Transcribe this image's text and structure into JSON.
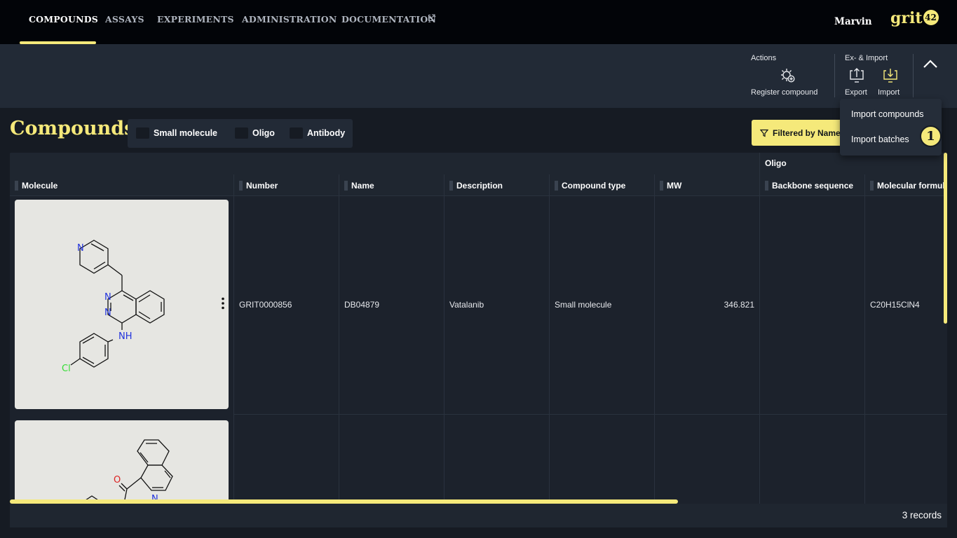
{
  "nav": {
    "items": [
      {
        "label": "COMPOUNDS"
      },
      {
        "label": "ASSAYS"
      },
      {
        "label": "EXPERIMENTS"
      },
      {
        "label": "ADMINISTRATION"
      },
      {
        "label": "DOCUMENTATION"
      }
    ],
    "user": "Marvin",
    "logo_text": "grit",
    "logo_badge": "42"
  },
  "toolbar": {
    "actions_label": "Actions",
    "register_label": "Register compound",
    "eximport_label": "Ex- & Import",
    "export_label": "Export",
    "import_label": "Import"
  },
  "page": {
    "title": "Compounds",
    "type_filters": [
      {
        "label": "Small molecule"
      },
      {
        "label": "Oligo"
      },
      {
        "label": "Antibody"
      }
    ],
    "filter_button": "Filtered by Name"
  },
  "grid": {
    "group_header": "Oligo",
    "columns": [
      {
        "label": "Molecule"
      },
      {
        "label": "Number"
      },
      {
        "label": "Name"
      },
      {
        "label": "Description"
      },
      {
        "label": "Compound type"
      },
      {
        "label": "MW"
      },
      {
        "label": "Backbone sequence"
      },
      {
        "label": "Molecular formula"
      }
    ],
    "rows": [
      {
        "number": "GRIT0000856",
        "name": "DB04879",
        "description": "Vatalanib",
        "compound_type": "Small molecule",
        "mw": "346.821",
        "backbone_sequence": "",
        "molecular_formula": "C20H15ClN4",
        "atoms": {
          "n1": "N",
          "n2": "N",
          "n3": "N",
          "nh": "NH",
          "cl": "Cl"
        }
      },
      {
        "number": "",
        "name": "",
        "description": "",
        "compound_type": "",
        "mw": "",
        "backbone_sequence": "",
        "molecular_formula": "",
        "atoms": {
          "o": "O",
          "n": "N"
        }
      }
    ],
    "records": "3 records"
  },
  "import_menu": {
    "items": [
      {
        "label": "Import compounds"
      },
      {
        "label": "Import batches"
      }
    ],
    "step_badge": "1"
  },
  "colors": {
    "accent": "#f5e97a",
    "nav_bg": "#020408",
    "toolbar_bg": "#222a36",
    "page_bg": "#161b23",
    "nitrogen": "#2233dd",
    "oxygen": "#dd2222",
    "chlorine": "#33dd33"
  }
}
